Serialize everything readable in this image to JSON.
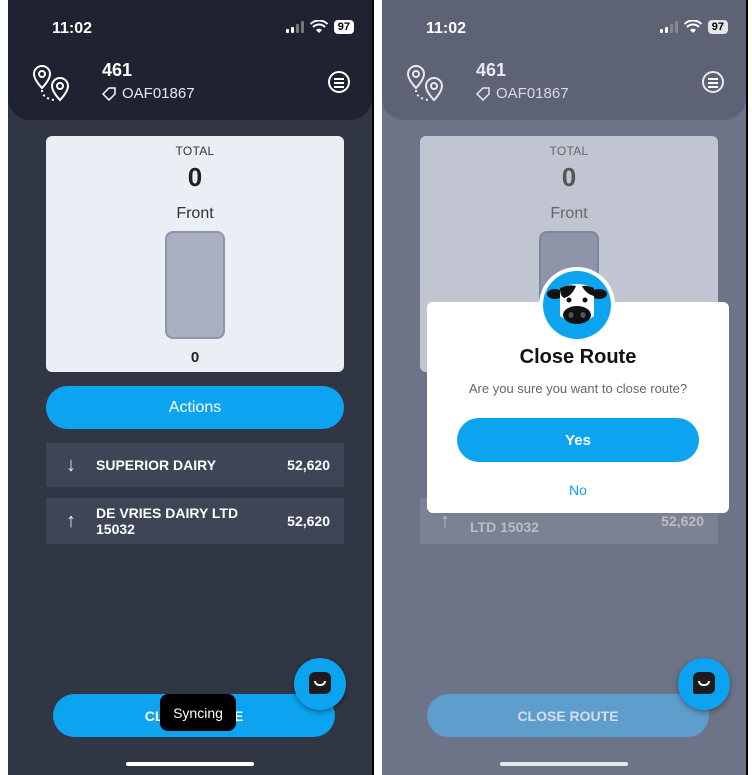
{
  "status_bar": {
    "time": "11:02",
    "battery": "97"
  },
  "header": {
    "route_number": "461",
    "route_code": "OAF01867"
  },
  "total_card": {
    "total_label": "TOTAL",
    "total_value": "0",
    "compartment_label": "Front",
    "compartment_value": "0"
  },
  "actions": {
    "label": "Actions"
  },
  "suppliers": [
    {
      "direction": "down-arrow-icon",
      "name": "SUPERIOR DAIRY",
      "amount": "52,620"
    },
    {
      "direction": "up-arrow-icon",
      "name": "DE VRIES DAIRY LTD 15032",
      "amount": "52,620"
    }
  ],
  "close_route": {
    "label": "CLOSE ROUTE",
    "left_visible_left": "CL",
    "left_visible_right": "TE"
  },
  "toast": {
    "text": "Syncing"
  },
  "dialog": {
    "title": "Close Route",
    "message": "Are you sure you want to close route?",
    "yes_label": "Yes",
    "no_label": "No",
    "obscured_supplier_name": "LTD 15032",
    "obscured_amount": "52,620"
  },
  "colors": {
    "accent": "#0ca4f1",
    "background": "#303644",
    "header": "#1f2230"
  },
  "icons": [
    "route-pins-icon",
    "tag-icon",
    "menu-icon",
    "chat-icon",
    "cow-icon"
  ]
}
